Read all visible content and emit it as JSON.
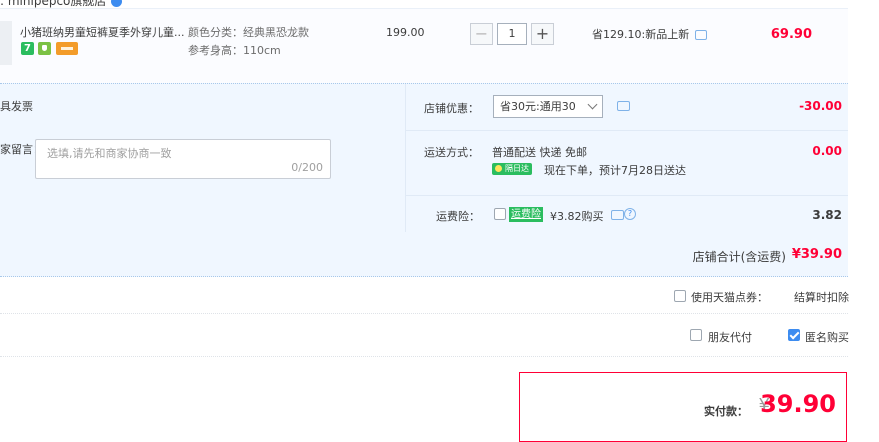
{
  "shop": {
    "name": ": minipepco旗舰店"
  },
  "product": {
    "title": "小猪班纳男童短裤夏季外穿儿童...",
    "tag_7": "7",
    "sku_color": "颜色分类：经典黑恐龙款",
    "sku_size": "参考身高：110cm",
    "unit_price": "199.00",
    "quantity": "1",
    "qty_minus": "−",
    "qty_plus": "+",
    "discount": "省129.10:新品上新",
    "line_total": "69.90"
  },
  "invoice": {
    "label": "具发票"
  },
  "memo": {
    "label": "家留言：",
    "placeholder": "选填,请先和商家协商一致",
    "count": "0/200"
  },
  "coupon": {
    "label": "店铺优惠：",
    "selected": "省30元:通用30",
    "amount": "-30.00"
  },
  "shipping": {
    "label": "运送方式：",
    "method": "普通配送 快递 免邮",
    "badge": "隔日达",
    "eta": "现在下单，预计7月28日送达",
    "amount": "0.00"
  },
  "insurance": {
    "label": "运费险：",
    "badge": "运费险",
    "price": "¥3.82购买",
    "amount": "3.82"
  },
  "shop_total": {
    "label": "店铺合计(含运费)",
    "value": "¥39.90"
  },
  "points": {
    "label": "使用天猫点券：",
    "note": "结算时扣除"
  },
  "payment_options": {
    "friend_pay": "朋友代付",
    "anonymous": "匿名购买"
  },
  "pay": {
    "label": "实付款：",
    "currency": "¥",
    "amount": "39.90"
  }
}
